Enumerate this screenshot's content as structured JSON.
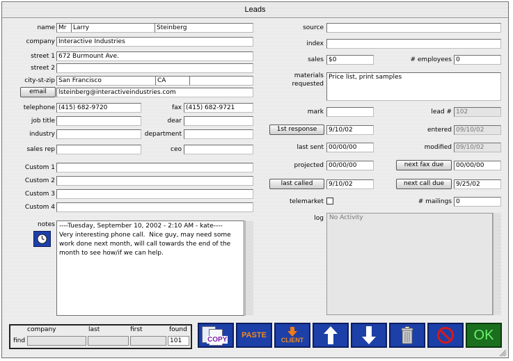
{
  "window": {
    "title": "Leads"
  },
  "labels": {
    "name": "name",
    "company": "company",
    "street1": "street 1",
    "street2": "street 2",
    "city_st_zip": "city-st-zip",
    "telephone": "telephone",
    "fax": "fax",
    "job_title": "job title",
    "dear": "dear",
    "industry": "industry",
    "department": "department",
    "sales_rep": "sales rep",
    "ceo": "ceo",
    "custom1": "Custom 1",
    "custom2": "Custom 2",
    "custom3": "Custom 3",
    "custom4": "Custom 4",
    "notes": "notes",
    "source": "source",
    "index": "index",
    "sales": "sales",
    "employees": "# employees",
    "materials_requested_1": "materials",
    "materials_requested_2": "requested",
    "mark": "mark",
    "lead_num": "lead #",
    "entered": "entered",
    "last_sent": "last sent",
    "modified": "modified",
    "projected": "projected",
    "telemarket": "telemarket",
    "mailings": "# mailings",
    "log": "log"
  },
  "buttons": {
    "email": "email",
    "first_response": "1st response",
    "next_fax_due": "next fax due",
    "last_called": "last called",
    "next_call_due": "next call due"
  },
  "fields": {
    "salutation": "Mr",
    "first_name": "Larry",
    "last_name": "Steinberg",
    "company": "Interactive Industries",
    "street1": "672 Burmount Ave.",
    "street2": "",
    "city": "San Francisco",
    "state": "CA",
    "zip": "",
    "email": "lsteinberg@interactiveindustries.com",
    "telephone": "(415) 682-9720",
    "fax": "(415) 682-9721",
    "job_title": "",
    "dear": "",
    "industry": "",
    "department": "",
    "sales_rep": "",
    "ceo": "",
    "custom1": "",
    "custom2": "",
    "custom3": "",
    "custom4": "",
    "notes": "----Tuesday, September 10, 2002 - 2:10 AM - kate----\nVery interesting phone call.  Nice guy, may need some work done next month, will call towards the end of the month to see how/if we can help.",
    "source": "",
    "index": "",
    "sales": "$0",
    "employees": "0",
    "materials_requested": "Price list, print samples",
    "mark": "",
    "lead_num": "102",
    "first_response": "9/10/02",
    "entered": "09/10/02",
    "last_sent": "00/00/00",
    "modified": "09/10/02",
    "projected": "00/00/00",
    "next_fax_due": "00/00/00",
    "last_called": "9/10/02",
    "next_call_due": "9/25/02",
    "mailings": "0",
    "log": "No Activity"
  },
  "find": {
    "company_header": "company",
    "last_header": "last",
    "first_header": "first",
    "found_header": "found",
    "find_label": "find",
    "company": "",
    "last": "",
    "first": "",
    "found": "101"
  },
  "toolbar": {
    "copy_label": "COPY",
    "paste_label": "PASTE",
    "client_label": "CLIENT",
    "ok_label": "OK"
  }
}
